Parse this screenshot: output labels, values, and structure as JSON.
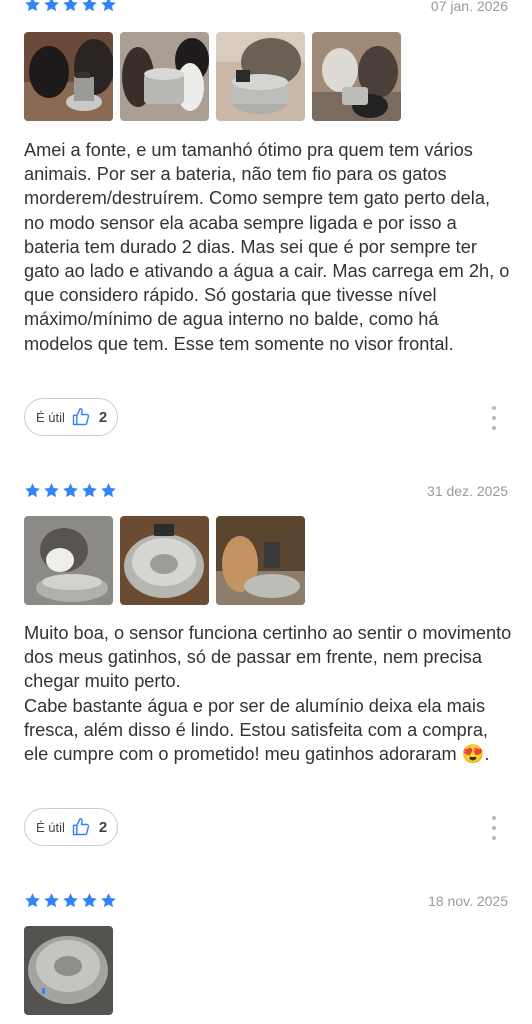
{
  "colors": {
    "star": "#3483fa",
    "thumb": "#3483fa",
    "text": "#333333",
    "muted": "#9a9a9a"
  },
  "reviews": [
    {
      "rating": 5,
      "date": "07 jan. 2026",
      "photo_count": 4,
      "paragraphs": [
        "Amei a fonte, e um tamanhó ótimo pra quem tem vários animais. Por ser a bateria, não tem fio para os gatos morderem/destruírem. Como sempre tem gato perto dela, no modo sensor ela acaba sempre ligada e por isso a bateria tem durado 2 dias. Mas sei que é por sempre ter gato ao lado e ativando a água a cair. Mas carrega em 2h, o que considero rápido. Só gostaria que tivesse nível máximo/mínimo de agua interno no balde, como há modelos que tem. Esse tem somente no visor frontal."
      ],
      "useful_label": "É útil",
      "useful_count": "2"
    },
    {
      "rating": 5,
      "date": "31 dez. 2025",
      "photo_count": 3,
      "paragraphs": [
        "Muito boa, o sensor funciona certinho ao sentir o movimento dos meus gatinhos, só de passar em frente, nem precisa chegar muito perto.",
        "Cabe bastante água e por ser de alumínio deixa ela mais fresca, além disso é lindo. Estou satisfeita com a compra, ele cumpre com o prometido! meu gatinhos adoraram 😍."
      ],
      "useful_label": "É útil",
      "useful_count": "2"
    },
    {
      "rating": 5,
      "date": "18 nov. 2025",
      "photo_count": 1
    }
  ]
}
